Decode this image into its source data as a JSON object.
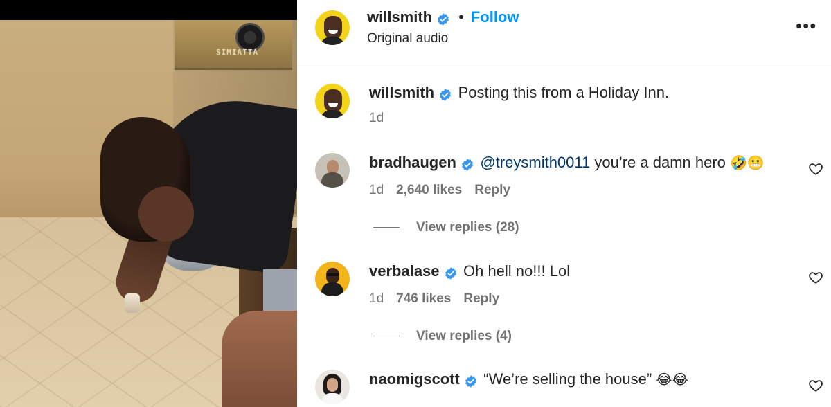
{
  "header": {
    "username": "willsmith",
    "separator": "•",
    "follow_label": "Follow",
    "subtitle": "Original audio",
    "more_icon": "more-horizontal-icon"
  },
  "caption": {
    "username": "willsmith",
    "text": "Posting this from a Holiday Inn.",
    "time": "1d"
  },
  "comments": [
    {
      "username": "bradhaugen",
      "mention": "@treysmith0011",
      "text": " you’re a damn hero ",
      "emoji": "🤣😬",
      "time": "1d",
      "likes": "2,640 likes",
      "reply_label": "Reply",
      "view_replies": "View replies (28)"
    },
    {
      "username": "verbalase",
      "text": "Oh hell no!!! Lol",
      "time": "1d",
      "likes": "746 likes",
      "reply_label": "Reply",
      "view_replies": "View replies (4)"
    },
    {
      "username": "naomigscott",
      "text": "“We’re selling the house” ",
      "emoji": "😂😂"
    }
  ],
  "colors": {
    "accent_blue": "#0095f6",
    "verified_blue": "#3897f0",
    "mention_blue": "#00376b",
    "secondary_text": "#737373"
  },
  "video": {
    "frame_text": "SIMIATTA"
  }
}
